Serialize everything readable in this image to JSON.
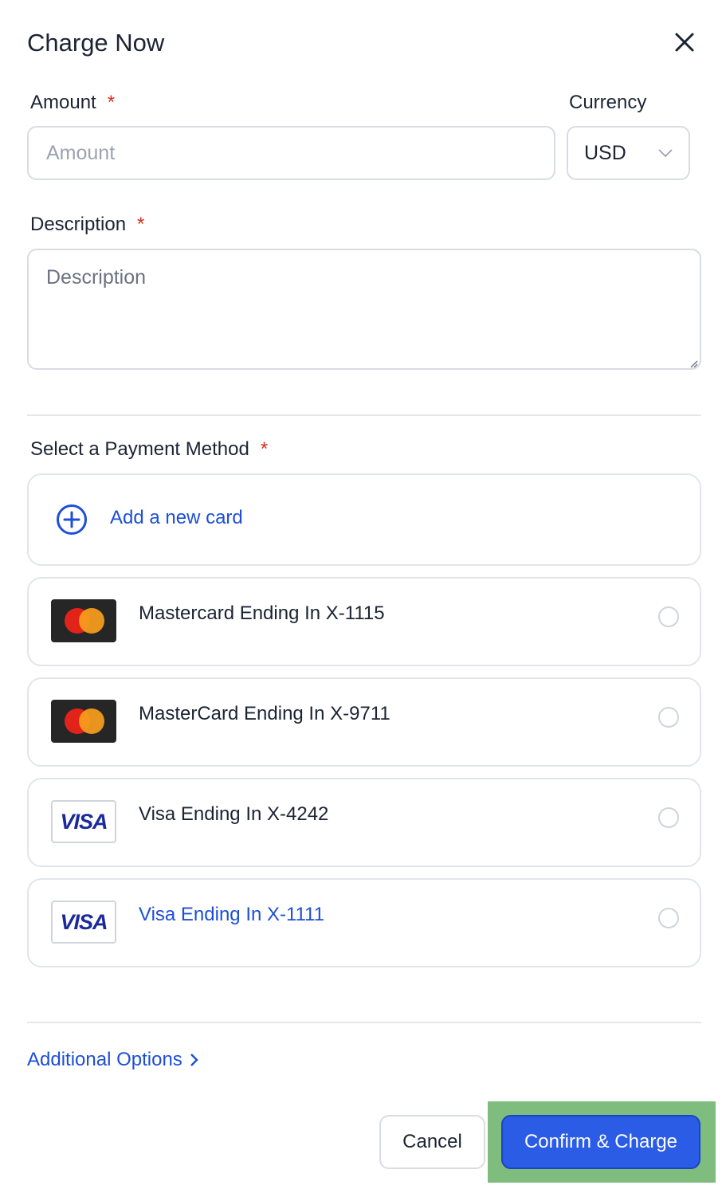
{
  "dialog": {
    "title": "Charge Now",
    "close_icon": "close-icon"
  },
  "form": {
    "amount_label": "Amount",
    "amount_placeholder": "Amount",
    "currency_label": "Currency",
    "currency_value": "USD",
    "description_label": "Description",
    "description_placeholder": "Description",
    "required_mark": "*"
  },
  "payment": {
    "label": "Select a Payment Method",
    "add_card_label": "Add a new card",
    "cards": [
      {
        "brand": "mastercard",
        "label": "Mastercard Ending In X-1115"
      },
      {
        "brand": "mastercard",
        "label": "MasterCard Ending In X-9711"
      },
      {
        "brand": "visa",
        "label": "Visa Ending In X-4242",
        "visa_text": "VISA"
      },
      {
        "brand": "visa",
        "label": "Visa Ending In X-1111",
        "visa_text": "VISA"
      }
    ]
  },
  "additional_options": "Additional Options",
  "actions": {
    "cancel": "Cancel",
    "confirm": "Confirm & Charge"
  },
  "colors": {
    "accent": "#2a5ce6",
    "link": "#1d4ed8",
    "required": "#d92d20",
    "highlight": "#7fbd7e"
  }
}
